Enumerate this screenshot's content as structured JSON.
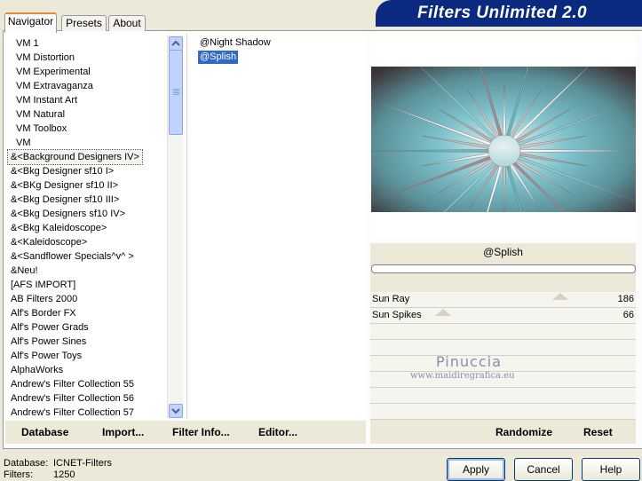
{
  "banner": {
    "title": "Filters Unlimited 2.0"
  },
  "tabs": [
    {
      "label": "Navigator"
    },
    {
      "label": "Presets"
    },
    {
      "label": "About"
    }
  ],
  "categories": [
    "VM 1",
    "VM Distortion",
    "VM Experimental",
    "VM Extravaganza",
    "VM Instant Art",
    "VM Natural",
    "VM Toolbox",
    "VM",
    "&<Background Designers IV>",
    "&<Bkg Designer sf10 I>",
    "&<BKg Designer sf10 II>",
    "&<Bkg Designer sf10 III>",
    "&<Bkg Designers sf10 IV>",
    "&<Bkg Kaleidoscope>",
    "&<Kaleidoscope>",
    "&<Sandflower Specials^v^ >",
    "&Neu!",
    "[AFS IMPORT]",
    "AB Filters 2000",
    "Alf's Border FX",
    "Alf's Power Grads",
    "Alf's Power Sines",
    "Alf's Power Toys",
    "AlphaWorks",
    "Andrew's Filter Collection 55",
    "Andrew's Filter Collection 56",
    "Andrew's Filter Collection 57"
  ],
  "selected_category_index": 8,
  "filters": [
    "@Night Shadow",
    "@Splish"
  ],
  "selected_filter_index": 1,
  "filter_name": "@Splish",
  "sliders": [
    {
      "label": "Sun Ray",
      "value": "186",
      "level": 186
    },
    {
      "label": "Sun Spikes",
      "value": "66",
      "level": 66
    }
  ],
  "watermark": {
    "line1": "Pinuccia",
    "line2": "www.maidiregrafica.eu"
  },
  "toolbar": {
    "database": "Database",
    "import": "Import...",
    "filter_info": "Filter Info...",
    "editor": "Editor...",
    "randomize": "Randomize",
    "reset": "Reset"
  },
  "status": {
    "database_label": "Database:",
    "database_value": "ICNET-Filters",
    "filters_label": "Filters:",
    "filters_value": "1250"
  },
  "buttons": {
    "apply": "Apply",
    "cancel": "Cancel",
    "help": "Help"
  },
  "colors": {
    "banner": "#0a2a80",
    "selection": "#316ac5",
    "tab_accent": "#e68b2c"
  }
}
